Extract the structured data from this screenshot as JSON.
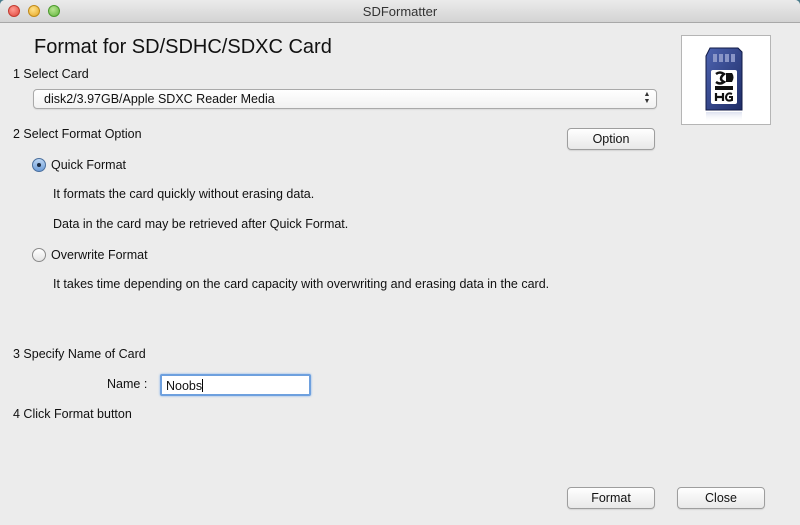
{
  "window": {
    "title": "SDFormatter"
  },
  "header": {
    "title": "Format for SD/SDHC/SDXC Card",
    "logo_icon": "sd-card-icon"
  },
  "step1": {
    "label": "1 Select Card",
    "selected_card": "disk2/3.97GB/Apple SDXC Reader Media"
  },
  "step2": {
    "label": "2 Select Format Option",
    "option_button": "Option",
    "quick": {
      "label": "Quick Format",
      "selected": true,
      "desc1": "It formats the card quickly without erasing data.",
      "desc2": "Data in the card may be retrieved after Quick Format."
    },
    "overwrite": {
      "label": "Overwrite Format",
      "selected": false,
      "desc": "It takes time depending on the card capacity with overwriting and erasing data in the card."
    }
  },
  "step3": {
    "label": "3 Specify Name of Card",
    "name_label": "Name :",
    "name_value": "Noobs"
  },
  "step4": {
    "label": "4 Click Format button"
  },
  "footer": {
    "format_button": "Format",
    "close_button": "Close"
  },
  "colors": {
    "accent": "#6ea0de",
    "window_bg": "#ececec",
    "sd_card": "#2d3f86"
  }
}
